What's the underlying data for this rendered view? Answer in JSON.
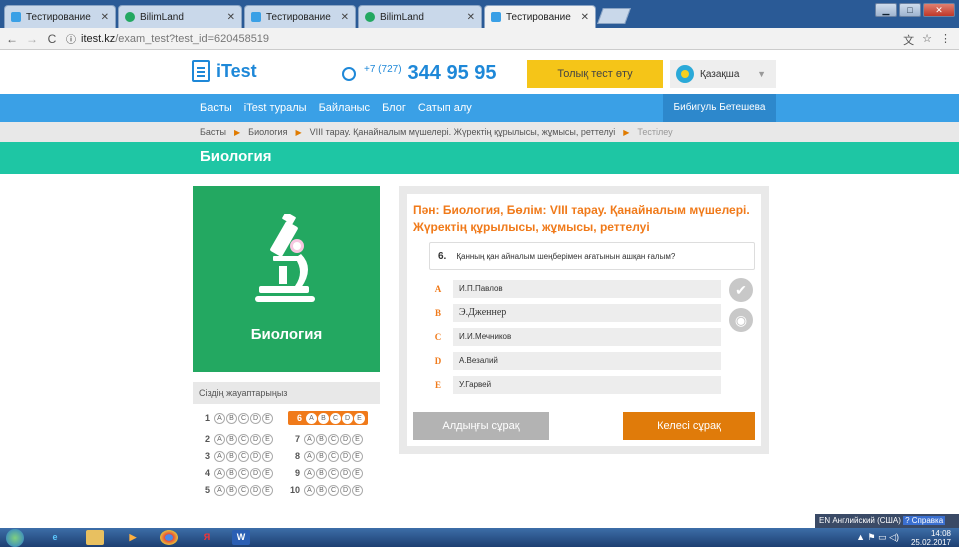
{
  "browser": {
    "tabs": [
      {
        "label": "Тестирование",
        "color": "#3aa0e6",
        "active": false
      },
      {
        "label": "BilimLand",
        "color": "#23a861",
        "active": false
      },
      {
        "label": "Тестирование",
        "color": "#3aa0e6",
        "active": false
      },
      {
        "label": "BilimLand",
        "color": "#23a861",
        "active": false
      },
      {
        "label": "Тестирование",
        "color": "#3aa0e6",
        "active": true
      }
    ],
    "url_host": "itest.kz",
    "url_path": "/exam_test?test_id=620458519",
    "back_icon": "back-arrow-icon",
    "forward_icon": "forward-arrow-icon",
    "reload_icon": "reload-icon",
    "info_icon": "info-icon",
    "star_icon": "star-icon",
    "menu_icon": "menu-icon"
  },
  "header": {
    "logo": "iTest",
    "phone_prefix": "+7 (727)",
    "phone_number": "344 95 95",
    "full_test_button": "Толық тест өту",
    "language": "Қазақша",
    "accent_color": "#3aa0e6",
    "button_color": "#f5c518"
  },
  "nav": {
    "items": [
      "Басты",
      "iTest туралы",
      "Байланыс",
      "Блог",
      "Сатып алу"
    ],
    "user": "Бибигуль Бетешева"
  },
  "breadcrumb": {
    "items": [
      "Басты",
      "Биология",
      "VIII тарау. Қанайналым мүшелері. Жүректің құрылысы, жұмысы, реттелуі",
      "Тестілеу"
    ]
  },
  "page_title": "Биология",
  "subject_card": {
    "name": "Биология",
    "icon": "microscope-icon",
    "color": "#23a861"
  },
  "answers": {
    "heading": "Сіздің жауаптарыңыз",
    "letters": [
      "A",
      "B",
      "C",
      "D",
      "E"
    ],
    "rows": [
      {
        "num": "1",
        "current": false
      },
      {
        "num": "2",
        "current": false
      },
      {
        "num": "3",
        "current": false
      },
      {
        "num": "4",
        "current": false
      },
      {
        "num": "5",
        "current": false
      },
      {
        "num": "6",
        "current": true
      },
      {
        "num": "7",
        "current": false
      },
      {
        "num": "8",
        "current": false
      },
      {
        "num": "9",
        "current": false
      },
      {
        "num": "10",
        "current": false
      }
    ]
  },
  "question": {
    "title": "Пән: Биология, Бөлім: VIII тарау. Қанайналым мүшелері. Жүректің құрылысы, жұмысы, реттелуі",
    "number": "6.",
    "text": "Қанның қан айналым шеңберімен ағатынын ашқан ғалым?",
    "options": [
      {
        "letter": "A",
        "text": "И.П.Павлов"
      },
      {
        "letter": "B",
        "text": "Э.Дженнер"
      },
      {
        "letter": "C",
        "text": "И.И.Мечников"
      },
      {
        "letter": "D",
        "text": "А.Везалий"
      },
      {
        "letter": "E",
        "text": "У.Гарвей"
      }
    ],
    "check_icon": "check-icon",
    "hint_icon": "signal-icon",
    "prev_button": "Алдыңғы сұрақ",
    "next_button": "Келесі сұрақ",
    "title_color": "#f07a1a"
  },
  "taskbar": {
    "language_tip": "EN Английский (США)",
    "help": "Справка",
    "time": "14:08",
    "date": "25.02.2017"
  }
}
